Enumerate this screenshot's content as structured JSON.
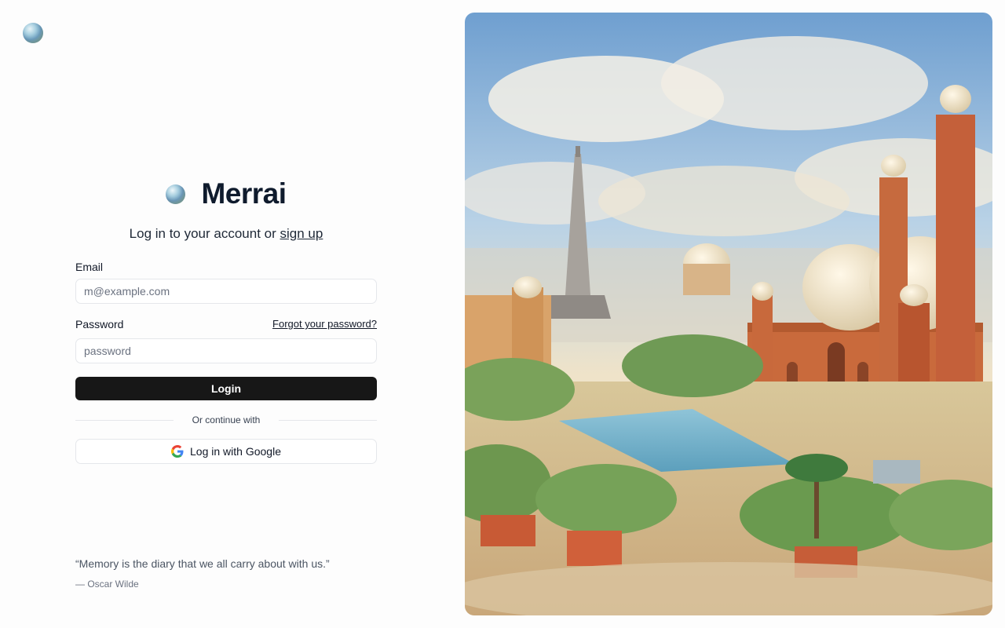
{
  "brand": {
    "name": "Merrai"
  },
  "subtitle": {
    "text": "Log in to your account or",
    "signup_link": "sign up"
  },
  "email": {
    "label": "Email",
    "placeholder": "m@example.com"
  },
  "password": {
    "label": "Password",
    "placeholder": "password",
    "forgot_link": "Forgot your password?"
  },
  "login_button": "Login",
  "divider_label": "Or continue with",
  "google_button": "Log in with Google",
  "quote": {
    "text": "“Memory is the diary that we all carry about with us.”",
    "author": "— Oscar Wilde"
  },
  "colors": {
    "primary_button": "#171717",
    "page_background": "#fdfdfd"
  },
  "icons": {
    "google": "google-icon",
    "logo": "logo-orb-icon"
  }
}
